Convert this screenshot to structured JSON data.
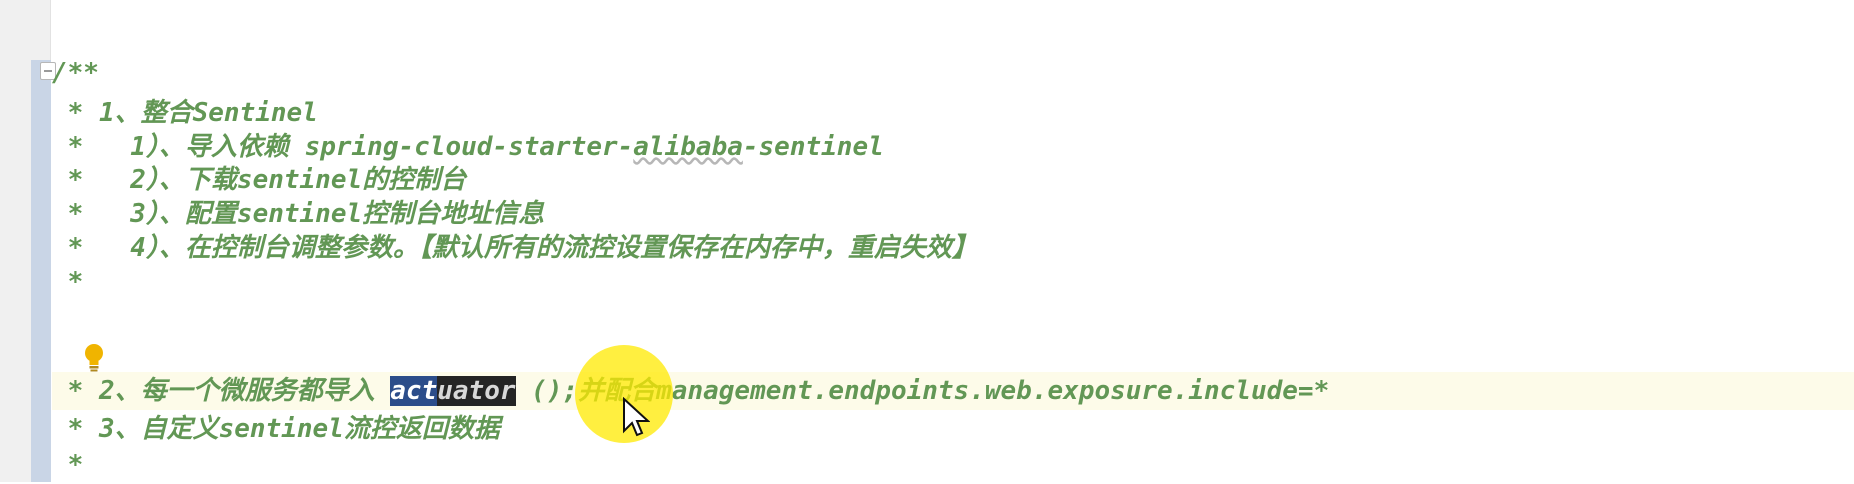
{
  "editor": {
    "lines": [
      "/**",
      " * 1、整合Sentinel",
      " *   1）、导入依赖 spring-cloud-starter-alibaba-sentinel",
      " *   2）、下载sentinel的控制台",
      " *   3）、配置sentinel控制台地址信息",
      " *   4）、在控制台调整参数。【默认所有的流控设置保存在内存中，重启失效】",
      " *",
      "",
      " * 2、每一个微服务都导入 actuator ();并配合management.endpoints.web.exposure.include=*",
      " * 3、自定义sentinel流控返回数据",
      " *"
    ],
    "line9": {
      "prefix": " * 2、每一个微服务都导入 ",
      "selected": "act",
      "word_rest": "uator",
      "suffix": " ();并配合management.endpoints.web.exposure.include=*"
    },
    "line3": {
      "prefix": " *   1）、导入依赖 spring-cloud-starter-",
      "squiggle": "alibaba",
      "suffix": "-sentinel"
    }
  },
  "icons": [
    "fold-icon",
    "lightbulb-icon",
    "mouse-cursor-icon"
  ],
  "colors": {
    "comment": "#629755",
    "selection": "#2c4d8a",
    "current_line": "#fdfbe9",
    "cursor_highlight": "#ffea00"
  }
}
